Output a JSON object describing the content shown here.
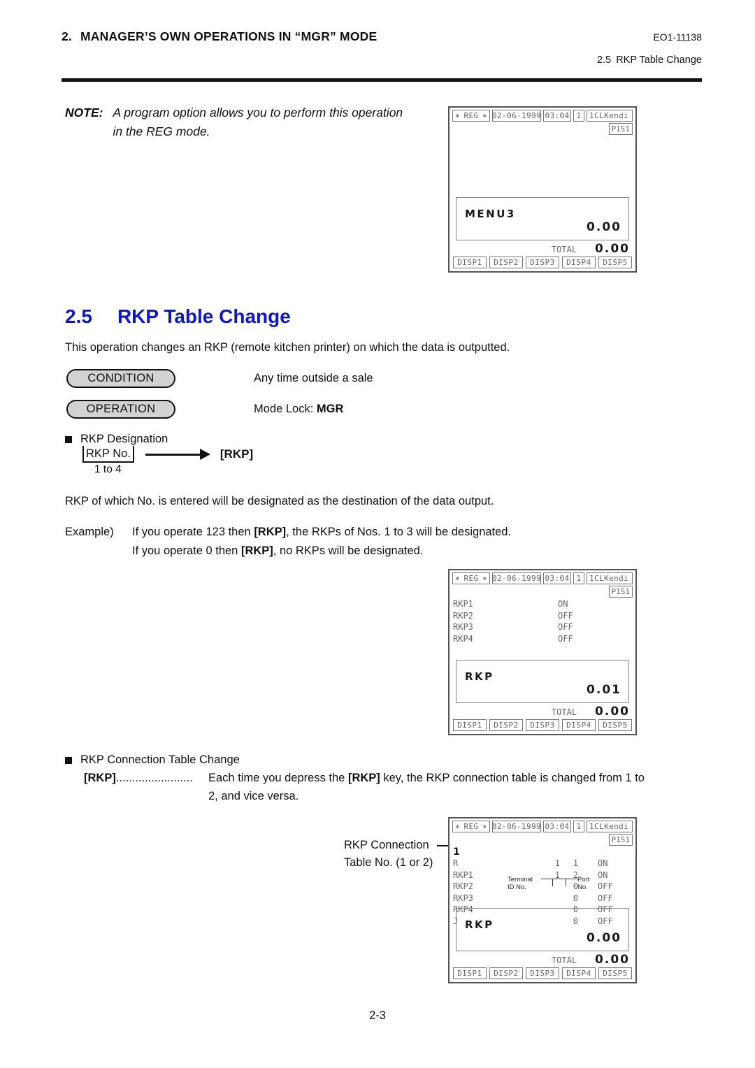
{
  "header": {
    "chapter_num": "2.",
    "chapter_title": "MANAGER’S OWN OPERATIONS IN “MGR” MODE",
    "doc_code": "EO1-11138",
    "running_sec_num": "2.5",
    "running_sec_title": "RKP Table Change"
  },
  "note": {
    "label": "NOTE:",
    "text": "A program option allows you to perform this operation in the REG mode."
  },
  "section": {
    "number": "2.5",
    "title": "RKP Table Change",
    "intro": "This operation changes an RKP (remote kitchen printer) on which the data is outputted."
  },
  "condition": {
    "pill_label": "CONDITION",
    "text": "Any time outside a sale"
  },
  "operation": {
    "pill_label": "OPERATION",
    "text_prefix": "Mode Lock: ",
    "text_value": "MGR"
  },
  "designation": {
    "heading": "RKP Designation",
    "key_entry": "RKP No.",
    "range": "1 to 4",
    "key": "[RKP]",
    "description": "RKP of which No. is entered will be designated as the destination of the data output.",
    "example_label": "Example)",
    "example_line1_a": "If you operate 123 then ",
    "example_line1_key": "[RKP]",
    "example_line1_b": ", the RKPs of Nos. 1 to 3 will be designated.",
    "example_line2_a": "If you operate 0 then ",
    "example_line2_key": "[RKP]",
    "example_line2_b": ", no RKPs will be designated."
  },
  "connection": {
    "heading": "RKP Connection Table Change",
    "key": "[RKP]",
    "dots": "........................",
    "text_a": "Each time you depress the ",
    "text_key": "[RKP]",
    "text_b": " key, the RKP connection table is changed from 1 to",
    "text_line2": "2, and vice versa.",
    "callout_line1": "RKP Connection",
    "callout_line2": "Table No. (1 or 2)"
  },
  "lcd_common": {
    "mode": "REG",
    "mode_star": "✶",
    "date": "02-06-1999",
    "time": "03:04",
    "reg_no": "1",
    "clerk": "1CLKendi",
    "ps_badge": "P1S1",
    "total_label": "TOTAL",
    "disp_buttons": [
      "DISP1",
      "DISP2",
      "DISP3",
      "DISP4",
      "DISP5"
    ]
  },
  "lcd1": {
    "amount_label": "MENU3",
    "amount_value": "0.00",
    "total_value": "0.00"
  },
  "lcd2": {
    "rows": [
      {
        "name": "RKP1",
        "status": "ON"
      },
      {
        "name": "RKP2",
        "status": "OFF"
      },
      {
        "name": "RKP3",
        "status": "OFF"
      },
      {
        "name": "RKP4",
        "status": "OFF"
      }
    ],
    "amount_label": "RKP",
    "amount_value": "0.01",
    "total_value": "0.00"
  },
  "lcd3": {
    "table_no": "1",
    "anno_terminal": "Terminal\nID No.",
    "anno_terminal_l1": "Terminal",
    "anno_terminal_l2": "ID No.",
    "anno_port_l1": "Port",
    "anno_port_l2": "No.",
    "rows": [
      {
        "name": "R",
        "terminal_id": "1",
        "port": "1",
        "status": "ON"
      },
      {
        "name": "RKP1",
        "terminal_id": "1",
        "port": "2",
        "status": "ON"
      },
      {
        "name": "RKP2",
        "terminal_id": "",
        "port": "0",
        "status": "OFF"
      },
      {
        "name": "RKP3",
        "terminal_id": "",
        "port": "0",
        "status": "OFF"
      },
      {
        "name": "RKP4",
        "terminal_id": "",
        "port": "0",
        "status": "OFF"
      },
      {
        "name": "J",
        "terminal_id": "",
        "port": "0",
        "status": "OFF"
      }
    ],
    "amount_label": "RKP",
    "amount_value": "0.00",
    "total_value": "0.00"
  },
  "footer": {
    "page": "2-3"
  },
  "colors": {
    "heading_blue": "#0d16c8",
    "pill_fill": "#d2d2d2",
    "lcd_text": "#6a6368"
  }
}
